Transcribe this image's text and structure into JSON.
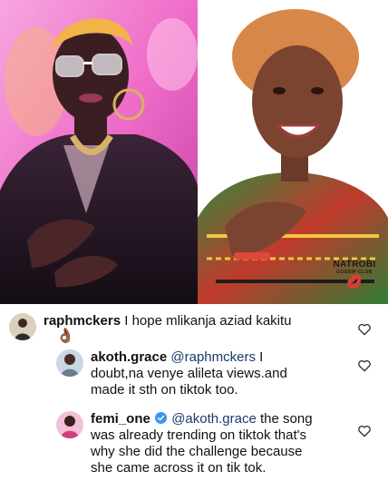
{
  "watermark": {
    "name": "NATROBI",
    "sub": "GOSSIP CLUB",
    "lips": "💋"
  },
  "comments": [
    {
      "username": "raphmckers",
      "text": "I hope mlikanja aziad kakitu",
      "emoji": "👌🏾",
      "liked": false
    },
    {
      "username": "akoth.grace",
      "mention": "@raphmckers",
      "line1": "I",
      "line2": "doubt,na venye alileta views.and",
      "line3": "made it sth on tiktok too.",
      "liked": false
    },
    {
      "username": "femi_one",
      "verified": true,
      "mention": "@akoth.grace",
      "line1": "the song",
      "line2": "was already trending on tiktok that's",
      "line3": "why she did the challenge because",
      "line4": "she came across it on tik tok.",
      "liked": false
    }
  ],
  "colors": {
    "mention": "#1b3b6e",
    "verified": "#3897f0",
    "left_bg": "#f06ec8",
    "right_bg": "#ffffff"
  }
}
